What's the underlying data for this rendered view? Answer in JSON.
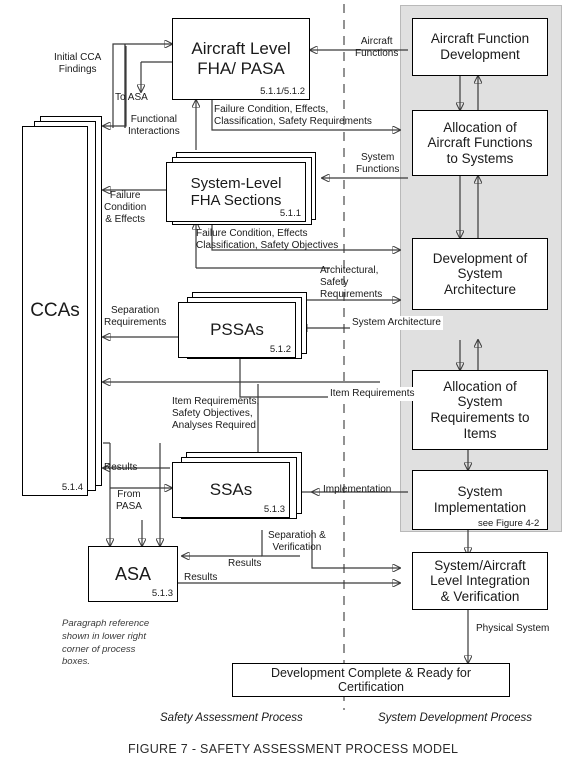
{
  "figure": {
    "caption": "FIGURE 7 - SAFETY ASSESSMENT PROCESS MODEL",
    "left_column_title": "Safety Assessment Process",
    "right_column_title": "System Development Process",
    "panel_note": "see Figure 4-2",
    "legend_note": "Paragraph reference shown in lower right corner of process boxes."
  },
  "boxes": {
    "aircraft_fha": {
      "label": "Aircraft Level\nFHA/ PASA",
      "ref": "5.1.1/5.1.2"
    },
    "system_fha": {
      "label": "System-Level\nFHA Sections",
      "ref": "5.1.1"
    },
    "pssas": {
      "label": "PSSAs",
      "ref": "5.1.2"
    },
    "ssas": {
      "label": "SSAs",
      "ref": "5.1.3"
    },
    "ccas": {
      "label": "CCAs",
      "ref": "5.1.4"
    },
    "asa": {
      "label": "ASA",
      "ref": "5.1.3"
    },
    "afd": {
      "label": "Aircraft Function\nDevelopment",
      "ref": ""
    },
    "alloc_func": {
      "label": "Allocation of\nAircraft Functions\nto Systems",
      "ref": ""
    },
    "dev_arch": {
      "label": "Development of\nSystem\nArchitecture",
      "ref": ""
    },
    "alloc_req": {
      "label": "Allocation of\nSystem\nRequirements to\nItems",
      "ref": ""
    },
    "sys_impl": {
      "label": "System\nImplementation",
      "ref": ""
    },
    "integration": {
      "label": "System/Aircraft\nLevel Integration\n& Verification",
      "ref": ""
    },
    "complete": {
      "label": "Development Complete & Ready for Certification",
      "ref": ""
    }
  },
  "flow_labels": {
    "initial_cca": "Initial CCA\nFindings",
    "to_asa": "To ASA",
    "functional_inter": "Functional\nInteractions",
    "failure_cond_req": "Failure Condition, Effects,\nClassification, Safety Requirements",
    "aircraft_functions": "Aircraft\nFunctions",
    "system_functions": "System\nFunctions",
    "failure_cond_eff": "Failure\nCondition\n& Effects",
    "fc_safety_obj": "Failure Condition, Effects\nClassification, Safety Objectives",
    "arch_safety_req": "Architectural,\nSafety\nRequirements",
    "system_arch": "System Architecture",
    "separation_req": "Separation\nRequirements",
    "item_requirements": "Item Requirements",
    "item_req_safety": "Item Requirements,\nSafety Objectives,\nAnalyses Required",
    "results_left": "Results",
    "from_pasa": "From\nPASA",
    "implementation": "Implementation",
    "separation_verif": "Separation &\nVerification",
    "results_mid": "Results",
    "results_bottom": "Results",
    "physical_system": "Physical System"
  },
  "colors": {
    "panel_fill": "#e0e0e0",
    "line": "#3a3a3a",
    "box_border": "#000000",
    "background": "#ffffff"
  }
}
